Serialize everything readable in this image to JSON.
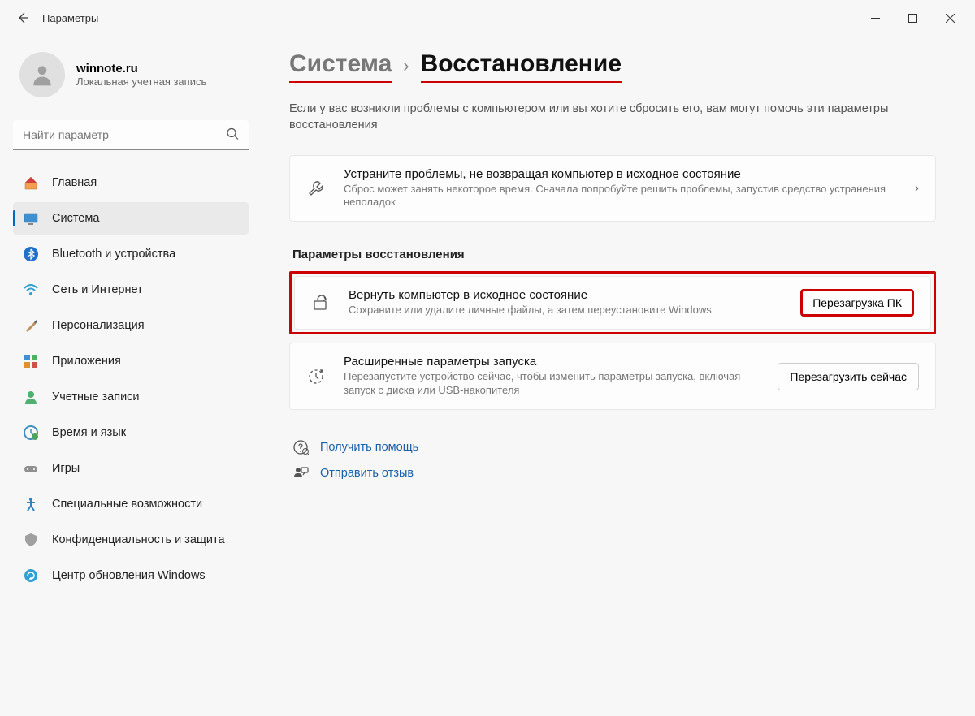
{
  "window": {
    "title": "Параметры"
  },
  "user": {
    "name": "winnote.ru",
    "subtitle": "Локальная учетная запись"
  },
  "search": {
    "placeholder": "Найти параметр"
  },
  "sidebar": {
    "items": [
      {
        "label": "Главная",
        "icon": "home"
      },
      {
        "label": "Система",
        "icon": "system",
        "active": true
      },
      {
        "label": "Bluetooth и устройства",
        "icon": "bluetooth"
      },
      {
        "label": "Сеть и Интернет",
        "icon": "wifi"
      },
      {
        "label": "Персонализация",
        "icon": "brush"
      },
      {
        "label": "Приложения",
        "icon": "apps"
      },
      {
        "label": "Учетные записи",
        "icon": "person"
      },
      {
        "label": "Время и язык",
        "icon": "clock"
      },
      {
        "label": "Игры",
        "icon": "gamepad"
      },
      {
        "label": "Специальные возможности",
        "icon": "accessibility"
      },
      {
        "label": "Конфиденциальность и защита",
        "icon": "shield"
      },
      {
        "label": "Центр обновления Windows",
        "icon": "update"
      }
    ]
  },
  "breadcrumb": {
    "parent": "Система",
    "current": "Восстановление"
  },
  "description": "Если у вас возникли проблемы с компьютером или вы хотите сбросить его, вам могут помочь эти параметры восстановления",
  "cards": {
    "troubleshoot": {
      "title": "Устраните проблемы, не возвращая компьютер в исходное состояние",
      "subtitle": "Сброс может занять некоторое время. Сначала попробуйте решить проблемы, запустив средство устранения неполадок"
    }
  },
  "section_header": "Параметры восстановления",
  "recovery": {
    "reset": {
      "title": "Вернуть компьютер в исходное состояние",
      "subtitle": "Сохраните или удалите личные файлы, а затем переустановите Windows",
      "button": "Перезагрузка ПК"
    },
    "advanced": {
      "title": "Расширенные параметры запуска",
      "subtitle": "Перезапустите устройство сейчас, чтобы изменить параметры запуска, включая запуск с диска или USB-накопителя",
      "button": "Перезагрузить сейчас"
    }
  },
  "footer": {
    "help": "Получить помощь",
    "feedback": "Отправить отзыв"
  }
}
